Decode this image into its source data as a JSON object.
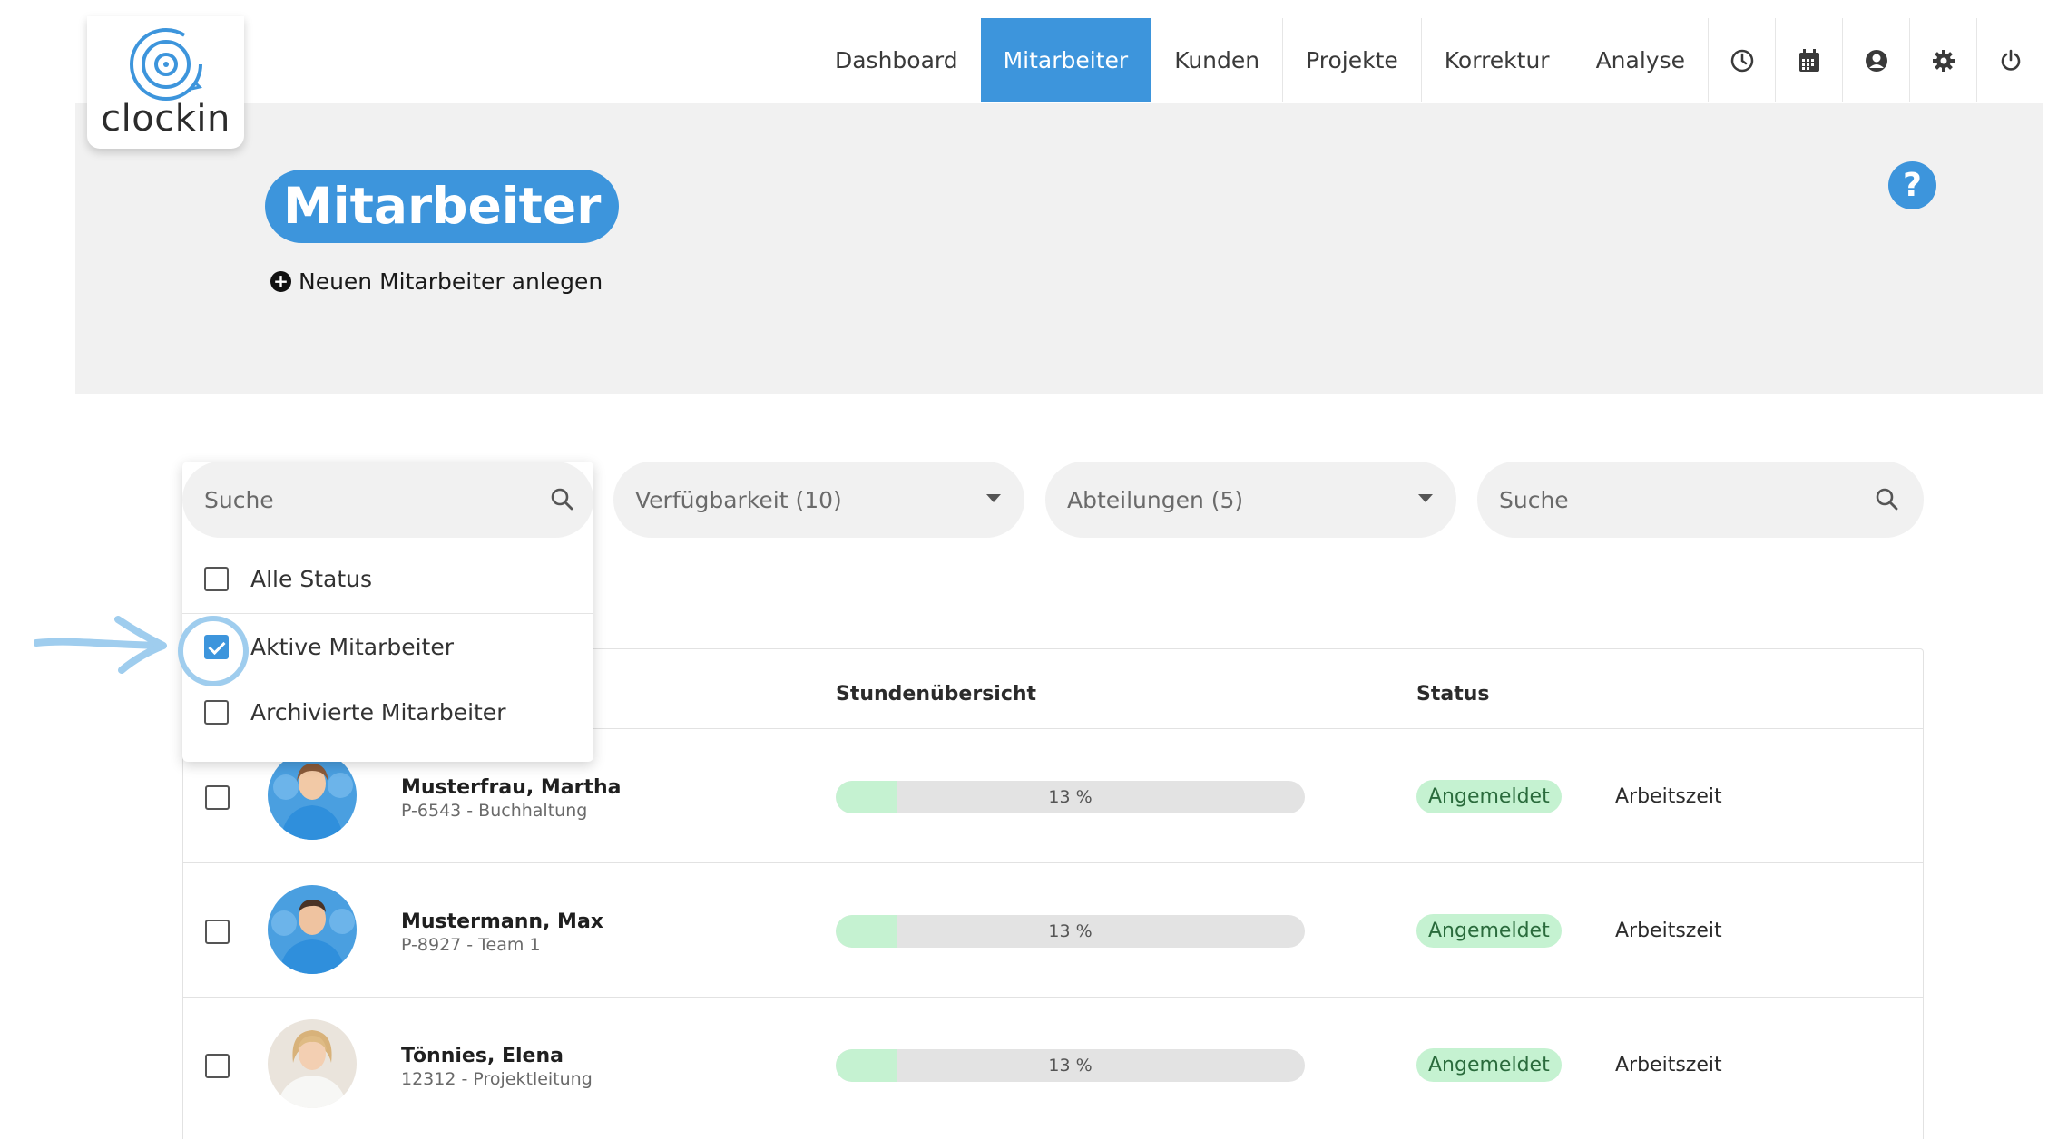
{
  "app": {
    "logo_text": "clockin"
  },
  "nav": {
    "items": [
      "Dashboard",
      "Mitarbeiter",
      "Kunden",
      "Projekte",
      "Korrektur",
      "Analyse"
    ],
    "active": "Mitarbeiter",
    "icons": [
      "clock-icon",
      "calendar-icon",
      "user-circle-icon",
      "gear-icon",
      "power-icon"
    ]
  },
  "page": {
    "title": "Mitarbeiter",
    "add_label": "Neuen Mitarbeiter anlegen",
    "help_label": "?"
  },
  "filters": {
    "status_search_placeholder": "Suche",
    "availability": "Verfügbarkeit (10)",
    "departments": "Abteilungen (5)",
    "search_placeholder": "Suche",
    "status_options": [
      {
        "label": "Alle Status",
        "checked": false
      },
      {
        "label": "Aktive Mitarbeiter",
        "checked": true
      },
      {
        "label": "Archivierte Mitarbeiter",
        "checked": false
      }
    ]
  },
  "table": {
    "headers": {
      "hours": "Stundenübersicht",
      "status": "Status"
    },
    "rows": [
      {
        "name": "Musterfrau, Martha",
        "sub": "P-6543 - Buchhaltung",
        "progress_label": "13 %",
        "progress": 0.13,
        "status": "Angemeldet",
        "action": "Arbeitszeit"
      },
      {
        "name": "Mustermann, Max",
        "sub": "P-8927 - Team 1",
        "progress_label": "13 %",
        "progress": 0.13,
        "status": "Angemeldet",
        "action": "Arbeitszeit"
      },
      {
        "name": "Tönnies, Elena",
        "sub": "12312 - Projektleitung",
        "progress_label": "13 %",
        "progress": 0.13,
        "status": "Angemeldet",
        "action": "Arbeitszeit"
      }
    ]
  },
  "colors": {
    "accent": "#3d95dc",
    "success_bg": "#c5f2d1",
    "success_text": "#2a6b3c",
    "highlight": "#9fcdee"
  }
}
